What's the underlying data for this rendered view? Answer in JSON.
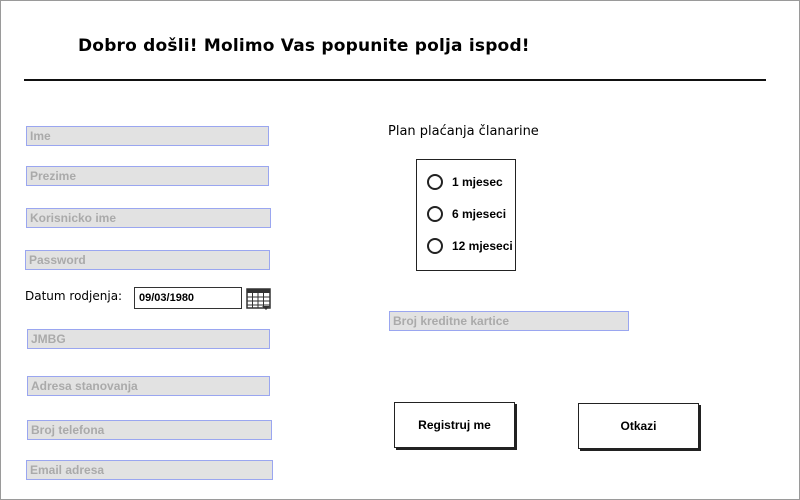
{
  "header": {
    "title": "Dobro došli! Molimo Vas popunite polja ispod!"
  },
  "form": {
    "first_name_placeholder": "Ime",
    "last_name_placeholder": "Prezime",
    "username_placeholder": "Korisnicko ime",
    "password_placeholder": "Password",
    "dob_label": "Datum rodjenja:",
    "dob_value": "09/03/1980",
    "jmbg_placeholder": "JMBG",
    "address_placeholder": "Adresa stanovanja",
    "phone_placeholder": "Broj telefona",
    "email_placeholder": "Email adresa"
  },
  "plan": {
    "title": "Plan plaćanja članarine",
    "options": [
      {
        "label": "1 mjesec",
        "selected": false
      },
      {
        "label": "6 mjeseci",
        "selected": false
      },
      {
        "label": "12 mjeseci",
        "selected": false
      }
    ],
    "card_placeholder": "Broj kreditne kartice"
  },
  "actions": {
    "register_label": "Registruj me",
    "cancel_label": "Otkazi"
  },
  "icons": {
    "calendar": "calendar-icon"
  },
  "colors": {
    "field_bg": "#e2e2e2",
    "field_border": "#9aa6f0",
    "placeholder": "#aaaaaa"
  }
}
